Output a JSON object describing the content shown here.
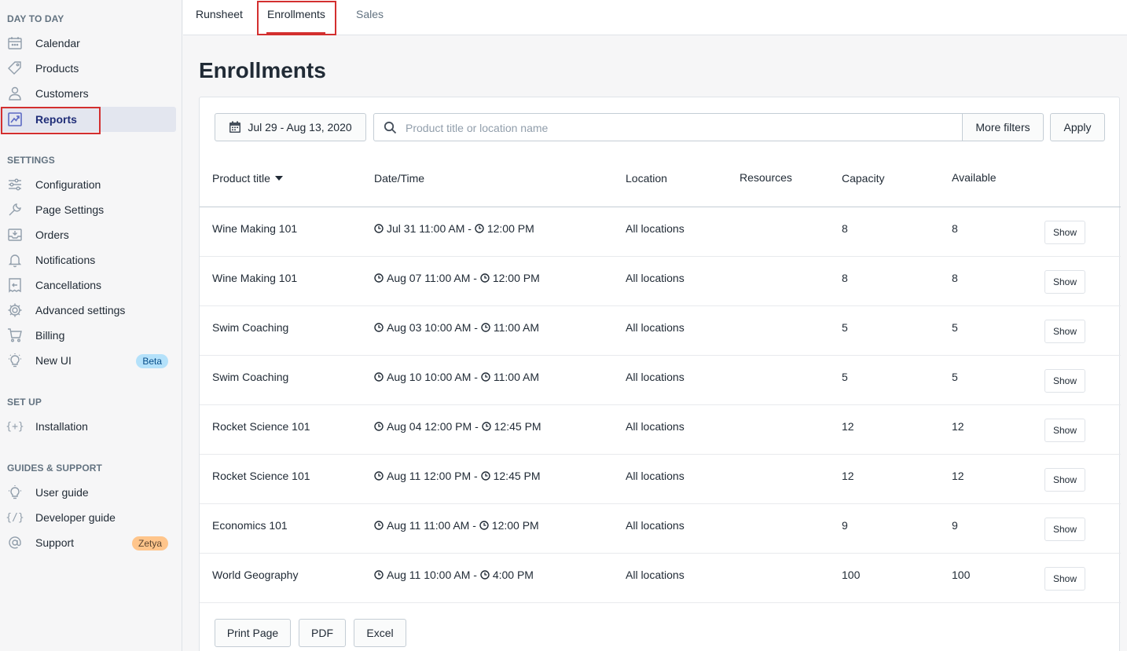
{
  "sidebar": {
    "sections": [
      {
        "title": "DAY TO DAY"
      },
      {
        "title": "SETTINGS"
      },
      {
        "title": "SET UP"
      },
      {
        "title": "GUIDES & SUPPORT"
      }
    ],
    "items": [
      {
        "label": "Calendar",
        "icon": "calendar-icon"
      },
      {
        "label": "Products",
        "icon": "tag-icon"
      },
      {
        "label": "Customers",
        "icon": "user-icon"
      },
      {
        "label": "Reports",
        "icon": "chart-icon",
        "active": true
      },
      {
        "label": "Configuration",
        "icon": "sliders-icon"
      },
      {
        "label": "Page Settings",
        "icon": "wrench-icon"
      },
      {
        "label": "Orders",
        "icon": "inbox-icon"
      },
      {
        "label": "Notifications",
        "icon": "bell-icon"
      },
      {
        "label": "Cancellations",
        "icon": "receipt-return-icon"
      },
      {
        "label": "Advanced settings",
        "icon": "gear-icon"
      },
      {
        "label": "Billing",
        "icon": "cart-icon"
      },
      {
        "label": "New UI",
        "icon": "lightbulb-icon",
        "badge": "Beta"
      },
      {
        "label": "Installation",
        "icon": "code-braces-plus-icon",
        "icon_text": "{+}"
      },
      {
        "label": "User guide",
        "icon": "lightbulb-icon"
      },
      {
        "label": "Developer guide",
        "icon": "code-slash-icon",
        "icon_text": "{/}"
      },
      {
        "label": "Support",
        "icon": "at-icon",
        "badge": "Zetya"
      }
    ]
  },
  "tabs": [
    {
      "label": "Runsheet"
    },
    {
      "label": "Enrollments",
      "active": true
    },
    {
      "label": "Sales"
    }
  ],
  "page": {
    "title": "Enrollments"
  },
  "filters": {
    "date_range": "Jul 29 - Aug 13, 2020",
    "search_placeholder": "Product title or location name",
    "search_value": "",
    "more_filters": "More filters",
    "apply": "Apply"
  },
  "table": {
    "columns": [
      "Product title",
      "Date/Time",
      "Location",
      "Resources",
      "Capacity",
      "Available"
    ],
    "sort_column": "Product title",
    "rows": [
      {
        "title": "Wine Making 101",
        "start": "Jul 31 11:00 AM",
        "end": "12:00 PM",
        "location": "All locations",
        "resources": "",
        "capacity": "8",
        "available": "8",
        "action": "Show"
      },
      {
        "title": "Wine Making 101",
        "start": "Aug 07 11:00 AM",
        "end": "12:00 PM",
        "location": "All locations",
        "resources": "",
        "capacity": "8",
        "available": "8",
        "action": "Show"
      },
      {
        "title": "Swim Coaching",
        "start": "Aug 03 10:00 AM",
        "end": "11:00 AM",
        "location": "All locations",
        "resources": "",
        "capacity": "5",
        "available": "5",
        "action": "Show"
      },
      {
        "title": "Swim Coaching",
        "start": "Aug 10 10:00 AM",
        "end": "11:00 AM",
        "location": "All locations",
        "resources": "",
        "capacity": "5",
        "available": "5",
        "action": "Show"
      },
      {
        "title": "Rocket Science 101",
        "start": "Aug 04 12:00 PM",
        "end": "12:45 PM",
        "location": "All locations",
        "resources": "",
        "capacity": "12",
        "available": "12",
        "action": "Show"
      },
      {
        "title": "Rocket Science 101",
        "start": "Aug 11 12:00 PM",
        "end": "12:45 PM",
        "location": "All locations",
        "resources": "",
        "capacity": "12",
        "available": "12",
        "action": "Show"
      },
      {
        "title": "Economics 101",
        "start": "Aug 11 11:00 AM",
        "end": "12:00 PM",
        "location": "All locations",
        "resources": "",
        "capacity": "9",
        "available": "9",
        "action": "Show"
      },
      {
        "title": "World Geography",
        "start": "Aug 11 10:00 AM",
        "end": "4:00 PM",
        "location": "All locations",
        "resources": "",
        "capacity": "100",
        "available": "100",
        "action": "Show"
      }
    ],
    "separator": " - "
  },
  "export": {
    "print": "Print Page",
    "pdf": "PDF",
    "excel": "Excel"
  },
  "colors": {
    "accent": "#5c6ac4",
    "highlight_box": "#d32f2f",
    "active_bg": "#e3e6ef"
  }
}
